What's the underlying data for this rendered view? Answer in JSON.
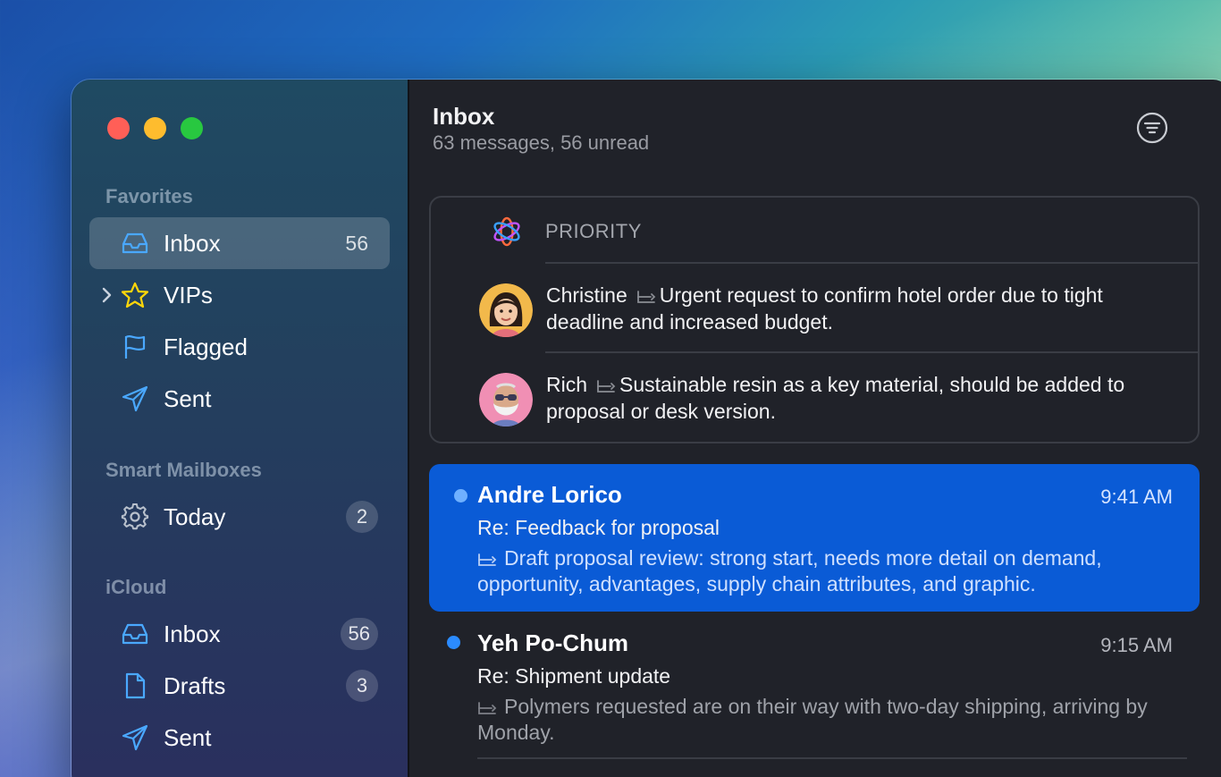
{
  "sidebar": {
    "favorites_title": "Favorites",
    "favorites": [
      {
        "label": "Inbox",
        "count": "56",
        "icon": "tray-icon"
      },
      {
        "label": "VIPs",
        "icon": "star-icon"
      },
      {
        "label": "Flagged",
        "icon": "flag-icon"
      },
      {
        "label": "Sent",
        "icon": "paperplane-icon"
      }
    ],
    "smart_title": "Smart Mailboxes",
    "smart": [
      {
        "label": "Today",
        "badge": "2",
        "icon": "gear-icon"
      }
    ],
    "icloud_title": "iCloud",
    "icloud": [
      {
        "label": "Inbox",
        "badge": "56",
        "icon": "tray-icon"
      },
      {
        "label": "Drafts",
        "badge": "3",
        "icon": "document-icon"
      },
      {
        "label": "Sent",
        "icon": "paperplane-icon"
      }
    ]
  },
  "header": {
    "title": "Inbox",
    "subtitle": "63 messages, 56 unread"
  },
  "priority": {
    "label": "PRIORITY",
    "items": [
      {
        "name": "Christine",
        "summary": "Urgent request to confirm hotel order due to tight deadline and increased budget."
      },
      {
        "name": "Rich",
        "summary": "Sustainable resin as a key material, should be added to proposal or desk version."
      }
    ]
  },
  "messages": [
    {
      "sender": "Andre Lorico",
      "time": "9:41 AM",
      "subject": "Re: Feedback for proposal",
      "preview": "Draft proposal review: strong start, needs more detail on demand, opportunity, advantages, supply chain attributes, and graphic.",
      "unread": true,
      "selected": true
    },
    {
      "sender": "Yeh Po-Chum",
      "time": "9:15 AM",
      "subject": "Re: Shipment update",
      "preview": "Polymers requested are on their way with two-day shipping, arriving by Monday.",
      "unread": true,
      "selected": false
    }
  ],
  "colors": {
    "accent": "#0a5bd6",
    "unread_dot": "#2b8bff",
    "traffic_red": "#ff5f57",
    "traffic_yellow": "#febc2e",
    "traffic_green": "#28c840"
  }
}
